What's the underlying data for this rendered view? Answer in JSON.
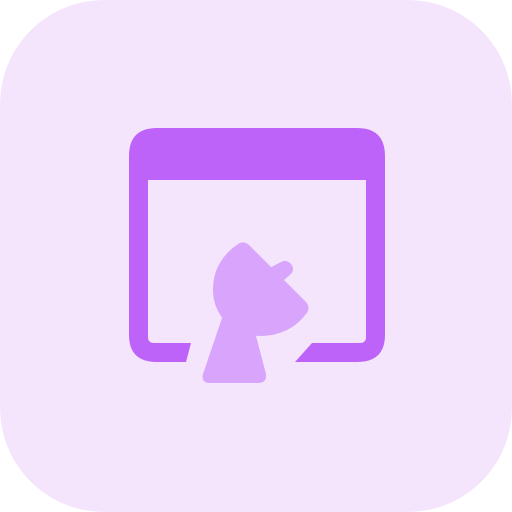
{
  "icon": {
    "name": "browser-satellite-dish-icon",
    "style": "two-tone"
  },
  "colors": {
    "tile_background": "#F4E5FC",
    "primary": "#BE63F9",
    "secondary": "#D9A4FC"
  }
}
